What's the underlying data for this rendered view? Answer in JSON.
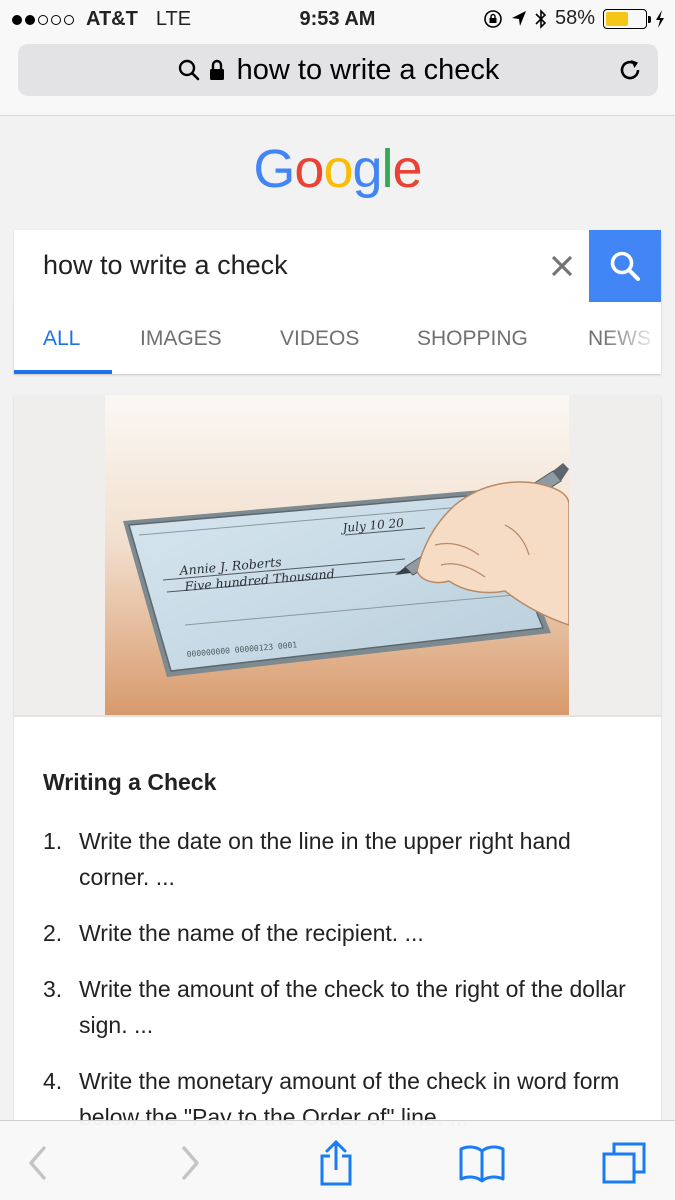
{
  "status_bar": {
    "signal_bars_filled": 2,
    "signal_bars_total": 5,
    "carrier": "AT&T",
    "network": "LTE",
    "time": "9:53 AM",
    "battery_percent": "58%",
    "battery_level": 0.58
  },
  "browser": {
    "url_text": "how to write a check",
    "icons": [
      "search-icon",
      "lock-icon",
      "reload-icon"
    ]
  },
  "google": {
    "logo_letters": [
      "G",
      "o",
      "o",
      "g",
      "l",
      "e"
    ],
    "logo_colors": [
      "#4285f4",
      "#ea4335",
      "#fbbc05",
      "#4285f4",
      "#34a853",
      "#ea4335"
    ]
  },
  "search": {
    "query": "how to write a check",
    "accent": "#4285f4"
  },
  "tabs": [
    {
      "label": "ALL",
      "active": true
    },
    {
      "label": "IMAGES",
      "active": false
    },
    {
      "label": "VIDEOS",
      "active": false
    },
    {
      "label": "SHOPPING",
      "active": false
    },
    {
      "label": "NEWS",
      "active": false
    }
  ],
  "result": {
    "image_handwriting": {
      "date": "July 10 20",
      "payee": "Annie J. Roberts",
      "amount_words": "Five hundred Thousand",
      "micr": "000000000 00000123 0001"
    },
    "heading": "Writing a Check",
    "steps": [
      {
        "num": "1.",
        "text": "Write the date on the line in the upper right hand corner. ..."
      },
      {
        "num": "2.",
        "text": "Write the name of the recipient. ..."
      },
      {
        "num": "3.",
        "text": "Write the amount of the check to the right of the dollar sign. ..."
      },
      {
        "num": "4.",
        "text": "Write the monetary amount of the check in word form below the \"Pay to the Order of\" line. ..."
      }
    ]
  },
  "toolbar": {
    "icons": [
      "back-icon",
      "forward-icon",
      "share-icon",
      "bookmarks-icon",
      "tabs-icon"
    ],
    "accent": "#1a7cf5"
  }
}
